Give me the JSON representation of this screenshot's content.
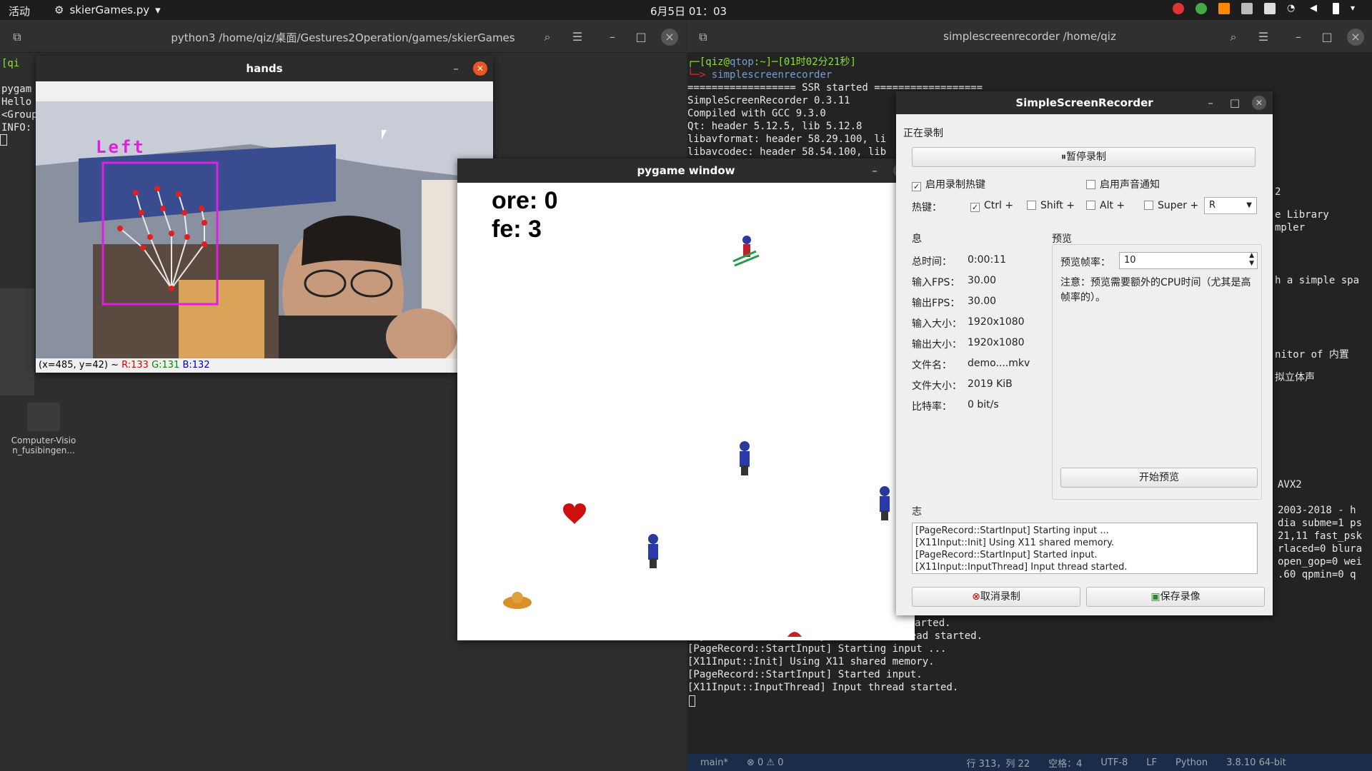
{
  "topbar": {
    "activities": "活动",
    "app_name": "skierGames.py",
    "clock": "6月5日 01：03"
  },
  "term_left": {
    "title": "python3 /home/qiz/桌面/Gestures2Operation/games/skierGames",
    "lines": [
      "[qi",
      "pygam",
      "Hello",
      "<Group",
      "INFO:"
    ]
  },
  "term_right": {
    "title": "simplescreenrecorder /home/qiz",
    "prompt_user": "qiz",
    "prompt_host": "qtop",
    "prompt_path": "~",
    "prompt_time": "[01时02分21秒]",
    "command": "simplescreenrecorder",
    "lines": [
      "================== SSR started ==================",
      "SimpleScreenRecorder 0.3.11",
      "Compiled with GCC 9.3.0",
      "Qt: header 5.12.5, lib 5.12.8",
      "libavformat: header 58.29.100, li",
      "libavcodec: header 58.54.100, lib"
    ],
    "side_fragments": [
      "2",
      "e Library",
      "mpler",
      "h a simple spa",
      "nitor of 内置",
      "拟立体声",
      "AVX2",
      "2003-2018 - h",
      "dia subme=1 ps",
      "21,11 fast_psk",
      "rlaced=0 blura",
      "open_gop=0 wei",
      ".60 qpmin=0 q"
    ],
    "bottom_lines": [
      "arted.",
      "[SynchronizerThread] Synchronizer thread started.",
      "[PageRecord::StartInput] Starting input ...",
      "[X11Input::Init] Using X11 shared memory.",
      "[PageRecord::StartInput] Started input.",
      "[X11Input::InputThread] Input thread started."
    ],
    "status_bar": [
      "main*",
      "⊗ 0 ⚠ 0",
      "行 313，列 22",
      "空格：4",
      "UTF-8",
      "LF",
      "Python",
      "3.8.10 64-bit"
    ]
  },
  "hands": {
    "title": "hands",
    "hand_label": "Left",
    "status_prefix": "(x=485, y=42) ~ ",
    "r": "R:133",
    "g": "G:131",
    "b": "B:132"
  },
  "pygame": {
    "title": "pygame window",
    "score": "ore: 0",
    "life": "fe: 3"
  },
  "ssr": {
    "title": "SimpleScreenRecorder",
    "recording_label": "正在录制",
    "pause_button": "暂停录制",
    "enable_hotkey": "启用录制热键",
    "enable_sound": "启用声音通知",
    "hotkey_label": "热键：",
    "mods": [
      "Ctrl +",
      "Shift +",
      "Alt +",
      "Super +"
    ],
    "key_value": "R",
    "info_label": "息",
    "preview_label": "预览",
    "stats": [
      {
        "k": "总时间：",
        "v": "0:00:11"
      },
      {
        "k": "输入FPS：",
        "v": "30.00"
      },
      {
        "k": "输出FPS：",
        "v": "30.00"
      },
      {
        "k": "输入大小：",
        "v": "1920x1080"
      },
      {
        "k": "输出大小：",
        "v": "1920x1080"
      },
      {
        "k": "文件名：",
        "v": "demo....mkv"
      },
      {
        "k": "文件大小：",
        "v": "2019 KiB"
      },
      {
        "k": "比特率：",
        "v": "0 bit/s"
      }
    ],
    "preview_rate_label": "预览帧率：",
    "preview_rate": "10",
    "preview_note": "注意：预览需要额外的CPU时间（尤其是高帧率的）。",
    "start_preview": "开始预览",
    "log_label": "志",
    "log": [
      "[PageRecord::StartInput] Starting input ...",
      "[X11Input::Init] Using X11 shared memory.",
      "[PageRecord::StartInput] Started input.",
      "[X11Input::InputThread] Input thread started."
    ],
    "cancel": "取消录制",
    "save": "保存录像"
  },
  "desktop": {
    "folder_label": "Computer-Visio n_fusibingen..."
  }
}
